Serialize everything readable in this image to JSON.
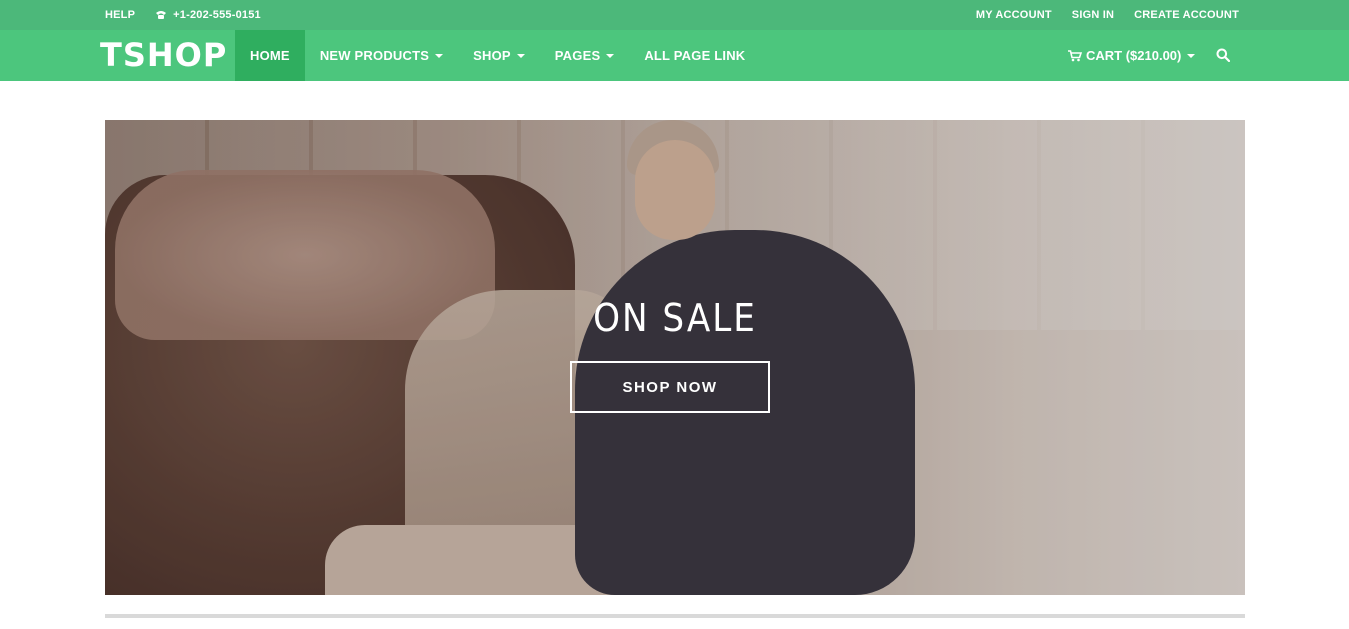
{
  "topbar": {
    "help": "HELP",
    "phone": "+1-202-555-0151",
    "my_account": "MY ACCOUNT",
    "sign_in": "SIGN IN",
    "create_account": "CREATE ACCOUNT"
  },
  "nav": {
    "logo": "TSHOP",
    "items": [
      {
        "label": "HOME"
      },
      {
        "label": "NEW PRODUCTS"
      },
      {
        "label": "SHOP"
      },
      {
        "label": "PAGES"
      },
      {
        "label": "ALL PAGE LINK"
      }
    ],
    "cart": "CART ($210.00)"
  },
  "hero": {
    "title": "ON SALE",
    "button": "SHOP NOW"
  },
  "colors": {
    "topbar": "#4cb87a",
    "navbar": "#4cc67d",
    "active": "#2fae5f"
  },
  "icons": [
    "phone-icon",
    "cart-icon",
    "search-icon",
    "caret-down-icon"
  ]
}
